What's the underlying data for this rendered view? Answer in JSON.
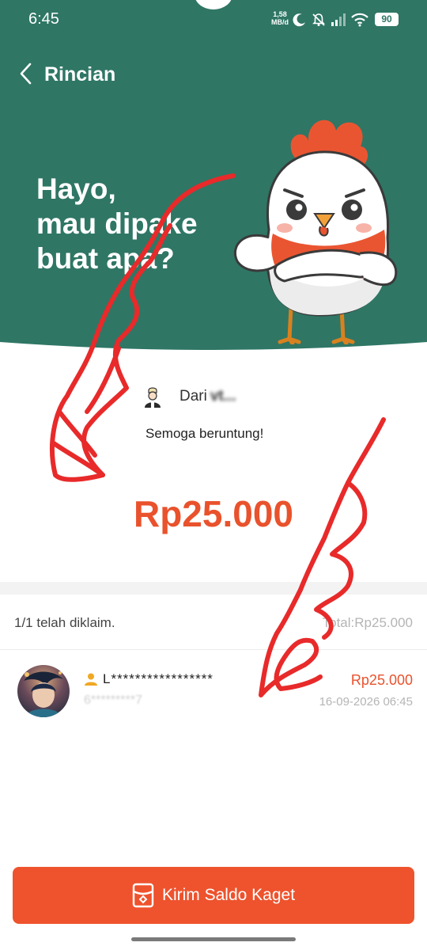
{
  "status_bar": {
    "time": "6:45",
    "net_speed_value": "1,58",
    "net_speed_unit": "MB/d",
    "battery": "90",
    "icons": [
      "moon-icon",
      "mute-bell-icon",
      "signal-icon",
      "wifi-icon",
      "battery-icon"
    ]
  },
  "header": {
    "title": "Rincian",
    "back_icon": "chevron-left-icon",
    "hero_lines": [
      "Hayo,",
      "mau dipake",
      "buat apa?"
    ],
    "background_color": "#2f7665"
  },
  "card": {
    "sender_label": "Dari",
    "sender_name": "vt...",
    "message": "Semoga beruntung!",
    "amount": "Rp25.000",
    "accent_color": "#e9522c"
  },
  "claims": {
    "status": "1/1 telah diklaim.",
    "total": "Total:Rp25.000",
    "entries": [
      {
        "name": "L*****************",
        "sub": "6*********7",
        "amount": "Rp25.000",
        "time": "16-09-2026 06:45"
      }
    ]
  },
  "footer": {
    "button_label": "Kirim Saldo Kaget",
    "button_icon": "gift-envelope-icon",
    "button_color": "#ee532d"
  }
}
